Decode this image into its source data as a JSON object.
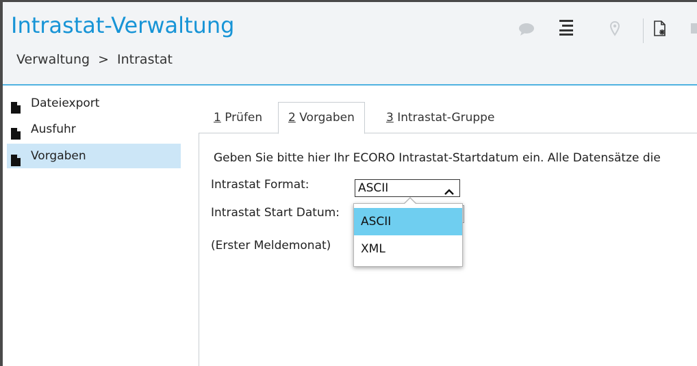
{
  "header": {
    "title": "Intrastat-Verwaltung",
    "breadcrumb": [
      "Verwaltung",
      "Intrastat"
    ],
    "breadcrumb_separator": ">",
    "toolbar_icons": [
      "chat-bubble-icon",
      "list-menu-icon",
      "location-pin-icon",
      "new-document-icon",
      "image-icon"
    ]
  },
  "sidebar": {
    "items": [
      {
        "label": "Dateiexport",
        "icon": "document-icon",
        "active": false
      },
      {
        "label": "Ausfuhr",
        "icon": "document-icon",
        "active": false
      },
      {
        "label": "Vorgaben",
        "icon": "document-icon",
        "active": true
      }
    ]
  },
  "tabs": [
    {
      "number": "1",
      "label": " Prüfen",
      "active": false
    },
    {
      "number": "2",
      "label": " Vorgaben",
      "active": true
    },
    {
      "number": "3",
      "label": " Intrastat-Gruppe",
      "active": false
    }
  ],
  "form": {
    "intro_text": "Geben Sie bitte hier Ihr ECORO Intrastat-Startdatum ein. Alle Datensätze die",
    "format_label": "Intrastat Format:",
    "format_value": "ASCII",
    "start_date_label": "Intrastat Start Datum:",
    "first_month_label": "(Erster Meldemonat)",
    "format_options": [
      {
        "label": "ASCII",
        "selected": true
      },
      {
        "label": "XML",
        "selected": false
      }
    ]
  },
  "colors": {
    "title": "#1794d6",
    "header_border": "#4fb2e0",
    "sidebar_active": "#cce6f7",
    "option_selected": "#6fcef0"
  }
}
